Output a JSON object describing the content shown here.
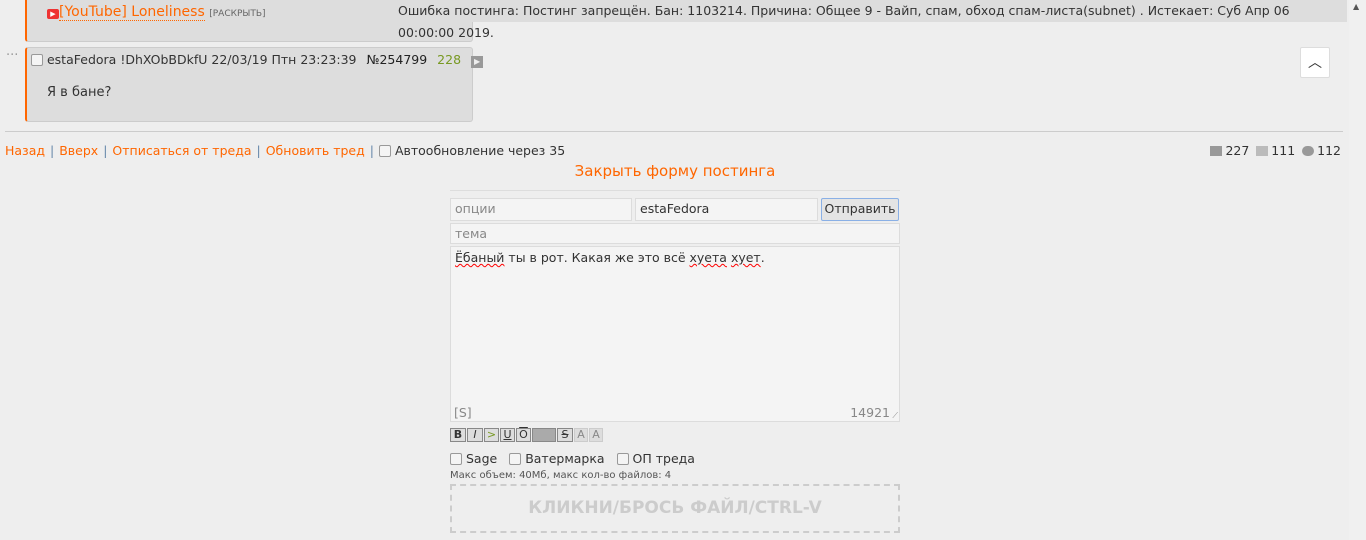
{
  "post_prev": {
    "link": "[YouTube] Loneliness",
    "expand": "[РАСКРЫТЬ]"
  },
  "error_message": "Ошибка постинга: Постинг запрещён. Бан: 1103214. Причина: Общее 9 - Вайп, спам, обход спам-листа(subnet) . Истекает: Суб Апр 06 00:00:00 2019.",
  "post": {
    "name": "estaFedora",
    "trip": "!DhXObBDkfU",
    "date": "22/03/19 Птн 23:23:39",
    "number": "№254799",
    "index": "228",
    "text": "Я в бане?",
    "dots": "···"
  },
  "nav": {
    "back": "Назад",
    "up": "Вверх",
    "unsubscribe": "Отписаться от треда",
    "refresh": "Обновить тред",
    "autorefresh": "Автообновление через 35",
    "sep": "|"
  },
  "stats": {
    "posts": "227",
    "images": "111",
    "posters": "112"
  },
  "form": {
    "close_label": "Закрыть форму постинга",
    "options_placeholder": "опции",
    "name_value": "estaFedora",
    "submit": "Отправить",
    "subject_placeholder": "тема",
    "message": "Ёбаный ты в рот. Какая же это всё хуета хует.",
    "spoiler_tag": "[S]",
    "char_count": "14921",
    "toolbar": [
      "B",
      "I",
      ">",
      "U",
      "O",
      "",
      "S",
      "A",
      "A"
    ],
    "sage": "Sage",
    "watermark": "Ватермарка",
    "op": "ОП треда",
    "limits": "Макс объем: 40Мб, макс кол-во файлов: 4",
    "dropzone": "КЛИКНИ/БРОСЬ ФАЙЛ/CTRL-V"
  }
}
